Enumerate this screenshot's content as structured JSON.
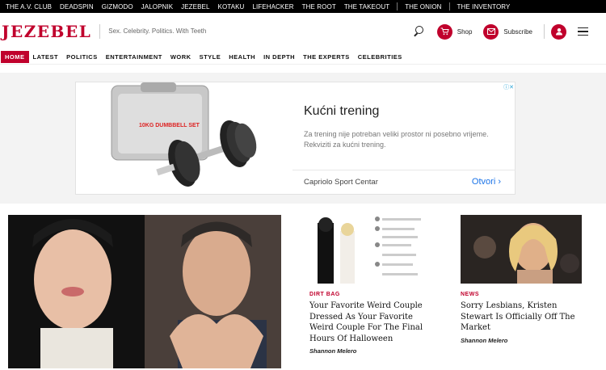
{
  "network": [
    "THE A.V. CLUB",
    "DEADSPIN",
    "GIZMODO",
    "JALOPNIK",
    "JEZEBEL",
    "KOTAKU",
    "LIFEHACKER",
    "THE ROOT",
    "THE TAKEOUT",
    "THE ONION",
    "THE INVENTORY"
  ],
  "header": {
    "logo": "JEZEBEL",
    "tagline": "Sex. Celebrity. Politics. With Teeth",
    "shop_label": "Shop",
    "subscribe_label": "Subscribe"
  },
  "nav": [
    "HOME",
    "LATEST",
    "POLITICS",
    "ENTERTAINMENT",
    "WORK",
    "STYLE",
    "HEALTH",
    "IN DEPTH",
    "THE EXPERTS",
    "CELEBRITIES"
  ],
  "ad": {
    "title": "Kućni trening",
    "description": "Za trening nije potreban veliki prostor ni posebno vrijeme. Rekviziti za kućni trening.",
    "advertiser": "Capriolo Sport Centar",
    "cta": "Otvori",
    "product_label": "10KG DUMBBELL SET"
  },
  "articles": [
    {
      "category": "DIRT BAG",
      "headline": "Your Favorite Weird Couple Dressed As Your Favorite Weird Couple For The Final Hours Of Halloween",
      "byline": "Shannon Melero"
    },
    {
      "category": "NEWS",
      "headline": "Sorry Lesbians, Kristen Stewart Is Officially Off The Market",
      "byline": "Shannon Melero"
    }
  ],
  "colors": {
    "brand": "#c0002c",
    "cta": "#1a73e8"
  }
}
